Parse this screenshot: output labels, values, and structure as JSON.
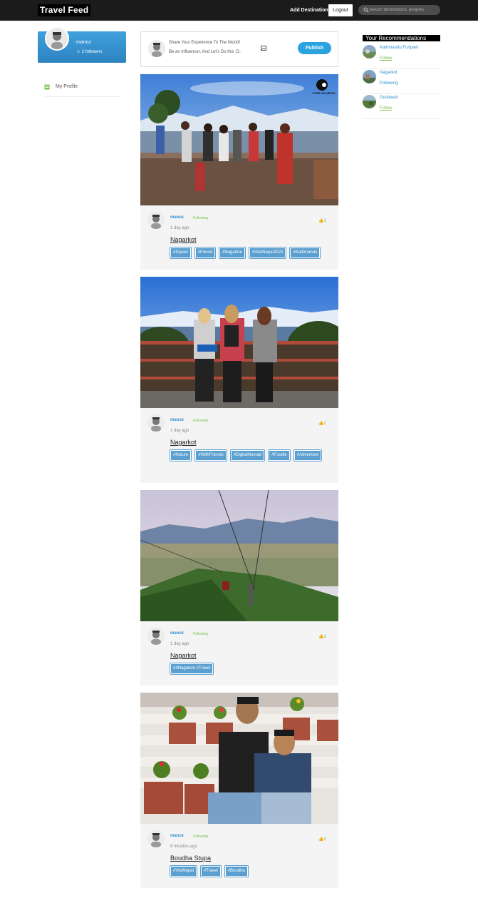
{
  "nav": {
    "brand": "Travel Feed",
    "add_destination": "Add Destination",
    "logout": "Logout",
    "search_placeholder": "Search destinations, peoples"
  },
  "profile": {
    "name": "manoz",
    "followers": "2 followers",
    "menu": [
      {
        "label": "My Profile",
        "icon": "profile-icon"
      }
    ]
  },
  "composer": {
    "line1": "Share Your Experience To The World!",
    "line2": "Be an Influencer, And Let's Do this :D.",
    "publish_label": "Publish",
    "image_icon": "image-icon"
  },
  "recommendations": {
    "title": "Your Recommendations",
    "items": [
      {
        "name": "Kathmandu Funpark",
        "action": "Follow"
      },
      {
        "name": "Nagarkot",
        "action": "Following"
      },
      {
        "name": "Godawari",
        "action": "Follow"
      }
    ]
  },
  "posts": [
    {
      "user": "manoz",
      "relation": "Following",
      "time": "1 day ago",
      "likes": "3",
      "location": "Nagarkot",
      "watermark": "EYES ON NEPAL",
      "tags": [
        "#Squad",
        "#Friend",
        "#Nagarkot",
        "#VisitNepal2020",
        "#Kathmandu"
      ]
    },
    {
      "user": "manoz",
      "relation": "Following",
      "time": "1 day ago",
      "likes": "2",
      "location": "Nagarkot",
      "tags": [
        "#Nature",
        "#WithFriends",
        "#DigitalNomad",
        "#Foodie",
        "#Adventure"
      ]
    },
    {
      "user": "manoz",
      "relation": "Following",
      "time": "1 day ago",
      "likes": "2",
      "location": "Nagarkot",
      "tags": [
        "##Nagarkot #Travel"
      ]
    },
    {
      "user": "manoz",
      "relation": "Following",
      "time": "8 minutes ago",
      "likes": "0",
      "location": "Boudha Stupa",
      "tags": [
        "#VistNepal",
        "#Travel",
        "#Boudha"
      ]
    }
  ],
  "colors": {
    "accent": "#29a4e0",
    "link": "#2f8fcf",
    "following": "#7cc04d",
    "tag": "#5a9fd0",
    "topbar": "#1b1b1b"
  }
}
